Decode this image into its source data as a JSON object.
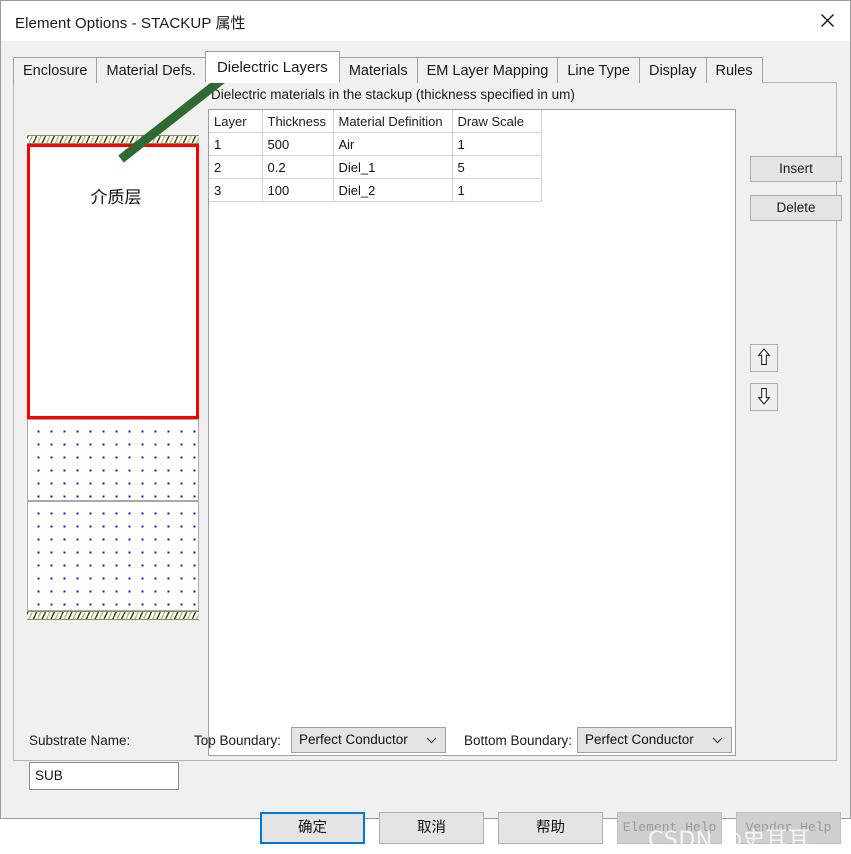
{
  "window": {
    "title": "Element Options - STACKUP 属性",
    "close_icon": "close-icon"
  },
  "tabs": [
    {
      "label": "Enclosure",
      "active": false
    },
    {
      "label": "Material Defs.",
      "active": false
    },
    {
      "label": "Dielectric Layers",
      "active": true
    },
    {
      "label": "Materials",
      "active": false
    },
    {
      "label": "EM Layer Mapping",
      "active": false
    },
    {
      "label": "Line Type",
      "active": false
    },
    {
      "label": "Display",
      "active": false
    },
    {
      "label": "Rules",
      "active": false
    }
  ],
  "group": {
    "label": "Dielectric materials in the stackup (thickness specified in um)"
  },
  "preview": {
    "dielectric_label": "介质层",
    "top_hatch": "hatched-boundary",
    "bottom_hatch": "hatched-boundary",
    "highlight_color": "#ff0000",
    "dot_color": "#1414e0"
  },
  "table": {
    "columns": [
      "Layer",
      "Thickness",
      "Material Definition",
      "Draw Scale"
    ],
    "rows": [
      {
        "layer": "1",
        "thickness": "500",
        "material": "Air",
        "draw_scale": "1",
        "selected": true
      },
      {
        "layer": "2",
        "thickness": "0.2",
        "material": "Diel_1",
        "draw_scale": "5",
        "selected": false
      },
      {
        "layer": "3",
        "thickness": "100",
        "material": "Diel_2",
        "draw_scale": "1",
        "selected": false
      }
    ],
    "selection_color": "#a9c9ec"
  },
  "side_buttons": {
    "insert": "Insert",
    "delete": "Delete",
    "move_up_icon": "arrow-up-icon",
    "move_down_icon": "arrow-down-icon"
  },
  "fields": {
    "substrate_name_label": "Substrate Name:",
    "substrate_name_value": "SUB",
    "top_boundary_label": "Top Boundary:",
    "top_boundary_value": "Perfect Conductor",
    "bottom_boundary_label": "Bottom Boundary:",
    "bottom_boundary_value": "Perfect Conductor"
  },
  "dialog_buttons": {
    "ok": "确定",
    "cancel": "取消",
    "help": "帮助",
    "element_help": "Element Help",
    "vendor_help": "Vendor Help"
  },
  "annotation": {
    "arrow_color": "#2d6b33"
  },
  "watermark": {
    "text": "CSDN @史耳耳"
  }
}
